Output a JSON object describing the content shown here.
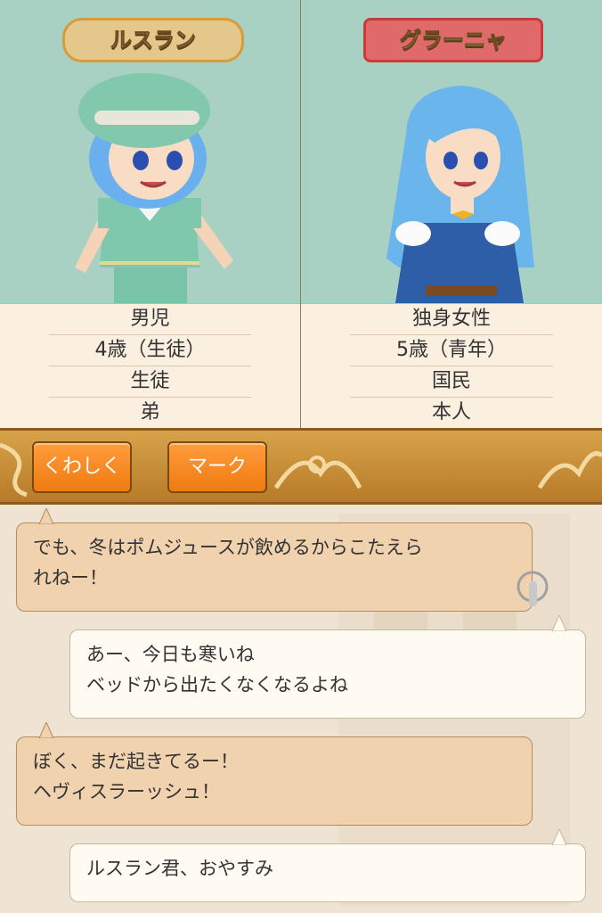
{
  "profiles": [
    {
      "name": "ルスラン",
      "info": [
        "男児",
        "4歳（生徒）",
        "生徒",
        "弟"
      ]
    },
    {
      "name": "グラーニャ",
      "info": [
        "独身女性",
        "5歳（青年）",
        "国民",
        "本人"
      ]
    }
  ],
  "toolbar": {
    "details_label": "くわしく",
    "mark_label": "マーク"
  },
  "chat": {
    "messages": [
      {
        "lines": [
          "でも、冬はポムジュースが飲めるからこたえら",
          "れねー！"
        ]
      },
      {
        "lines": [
          "あー、今日も寒いね",
          "ベッドから出たくなくなるよね"
        ]
      },
      {
        "lines": [
          "ぼく、まだ起きてるー！",
          "ヘヴィスラーッシュ！"
        ]
      },
      {
        "lines": [
          "ルスラン君、おやすみ"
        ]
      }
    ]
  },
  "colors": {
    "portrait_bg": "#a9d1c3",
    "info_bg": "#fbefe0",
    "toolbar_gold": "#d7a34a",
    "button_orange": "#f07a10",
    "bubble_tan": "#f0d2ae",
    "bubble_white": "#fffaf2"
  },
  "icons": [
    "tap-finger-icon"
  ]
}
